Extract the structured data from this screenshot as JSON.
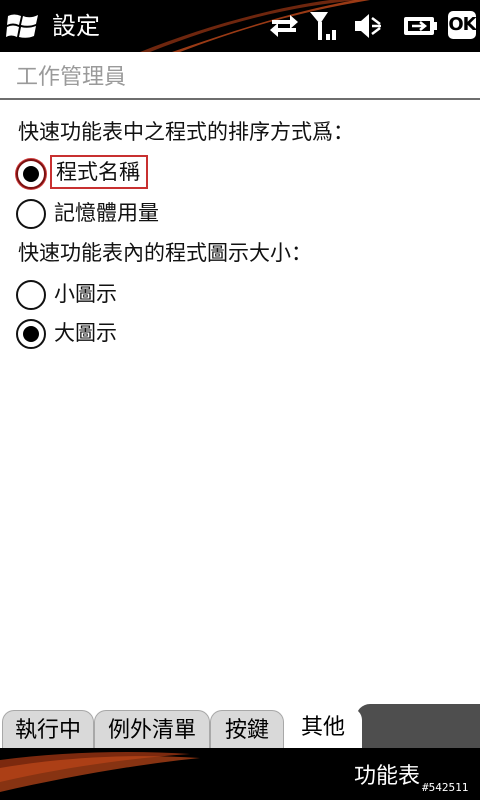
{
  "status_bar": {
    "title": "設定",
    "ok_label": "OK",
    "icons": [
      "windows-start-icon",
      "data-transfer-icon",
      "signal-strength-icon",
      "volume-muted-icon",
      "battery-charging-icon"
    ]
  },
  "header": {
    "title": "工作管理員"
  },
  "content": {
    "sort_section": {
      "label": "快速功能表中之程式的排序方式爲：",
      "options": [
        {
          "label": "程式名稱",
          "selected": true,
          "focused": true
        },
        {
          "label": "記憶體用量",
          "selected": false,
          "focused": false
        }
      ]
    },
    "icon_size_section": {
      "label": "快速功能表內的程式圖示大小：",
      "options": [
        {
          "label": "小圖示",
          "selected": false
        },
        {
          "label": "大圖示",
          "selected": true
        }
      ]
    }
  },
  "tabs": [
    {
      "label": "執行中",
      "active": false
    },
    {
      "label": "例外清單",
      "active": false
    },
    {
      "label": "按鍵",
      "active": false
    },
    {
      "label": "其他",
      "active": true
    }
  ],
  "softkeys": {
    "right": "功能表"
  },
  "watermark": "#542511",
  "colors": {
    "accent": "#c83030",
    "swoosh": "#c0481a",
    "bar": "#000000"
  }
}
